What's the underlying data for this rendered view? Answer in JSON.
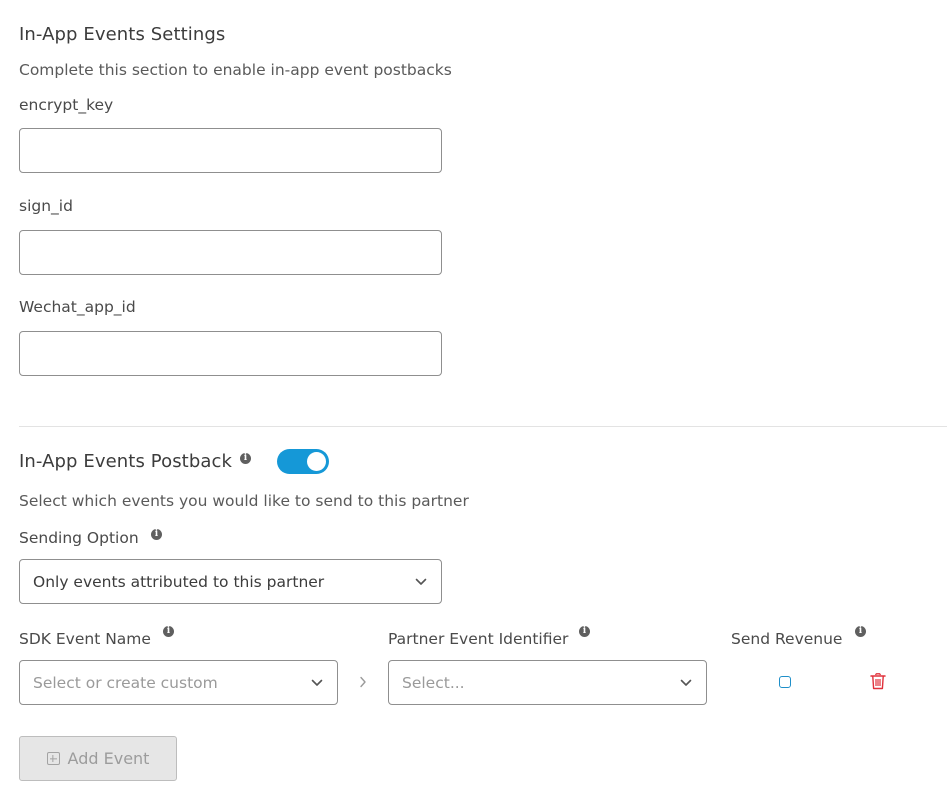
{
  "settings": {
    "title": "In-App Events Settings",
    "description": "Complete this section to enable in-app event postbacks",
    "fields": [
      {
        "label": "encrypt_key",
        "value": "",
        "placeholder": ""
      },
      {
        "label": "sign_id",
        "value": "",
        "placeholder": ""
      },
      {
        "label": "Wechat_app_id",
        "value": "",
        "placeholder": ""
      }
    ]
  },
  "postback": {
    "title": "In-App Events Postback",
    "toggle_on": true,
    "description": "Select which events you would like to send to this partner",
    "sending_option": {
      "label": "Sending Option",
      "selected": "Only events attributed to this partner"
    },
    "mapping": {
      "columns": {
        "sdk_event": "SDK Event Name",
        "partner_event": "Partner Event Identifier",
        "send_revenue": "Send Revenue"
      },
      "row": {
        "sdk_event_placeholder": "Select or create custom",
        "partner_event_placeholder": "Select...",
        "send_revenue_checked": false
      }
    },
    "add_event_label": "Add Event"
  },
  "icons": {
    "info": "info-icon",
    "chevron": "chevron-down-icon",
    "separator": "chevron-right-icon",
    "delete": "trash-icon",
    "add": "plus-square-icon"
  },
  "colors": {
    "accent": "#1598d7",
    "delete": "#e0303a",
    "checkbox": "#1f8fc9"
  }
}
